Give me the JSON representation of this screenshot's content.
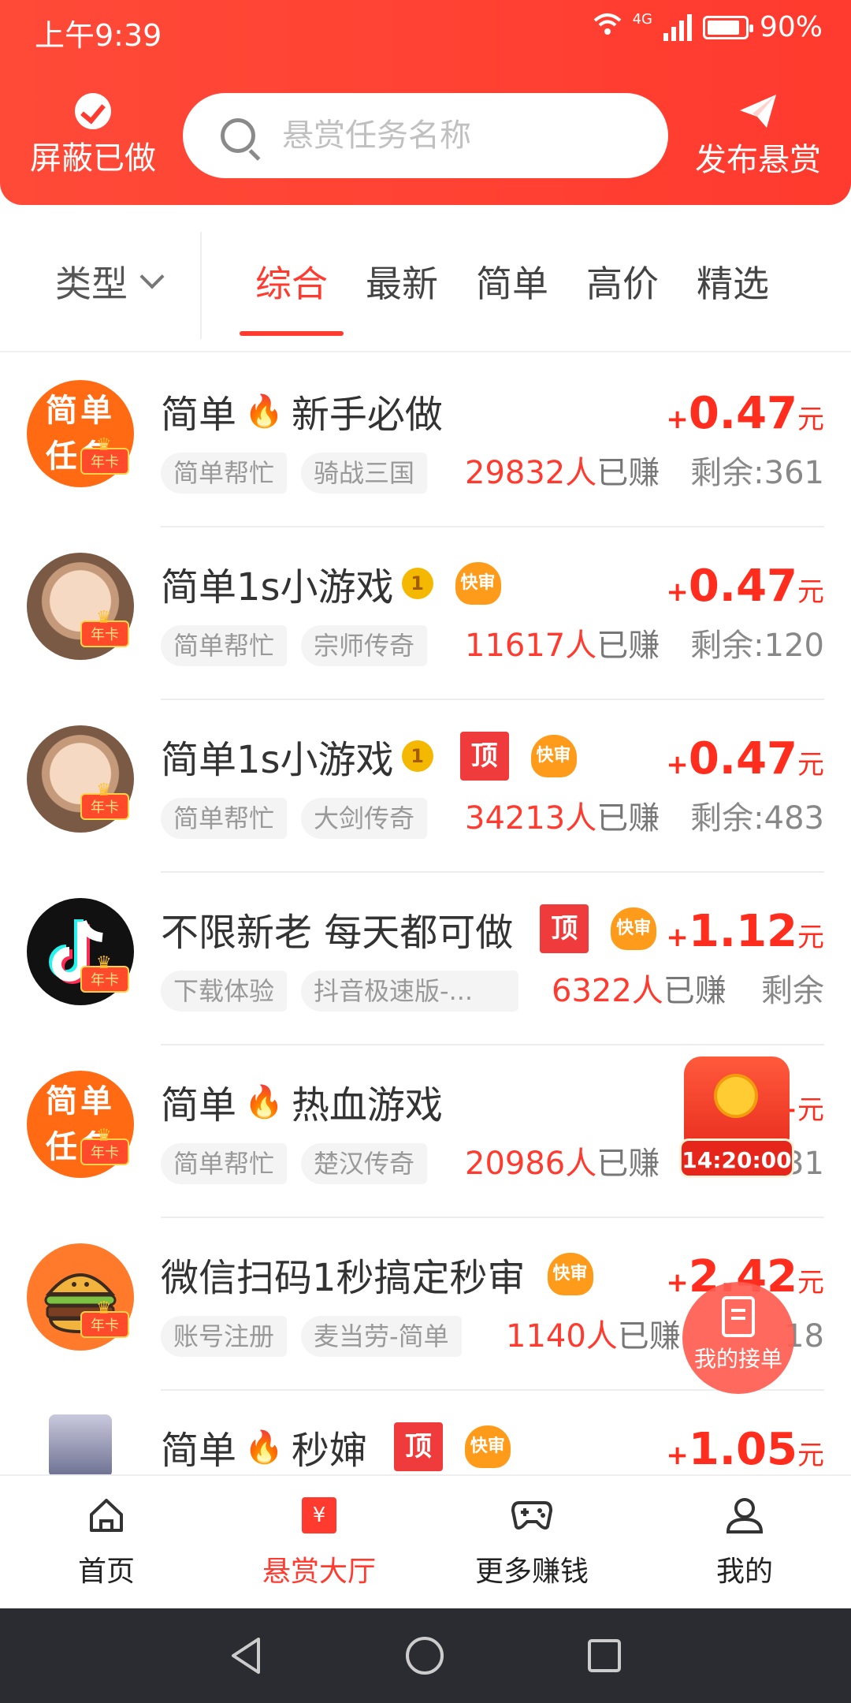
{
  "status": {
    "time": "上午9:39",
    "network": "4G",
    "battery": "90%"
  },
  "header": {
    "hide_done": "屏蔽已做",
    "search_placeholder": "悬赏任务名称",
    "publish": "发布悬赏"
  },
  "filter": {
    "type_label": "类型",
    "tabs": [
      "综合",
      "最新",
      "简单",
      "高价",
      "精选"
    ],
    "active_tab": "综合"
  },
  "avatars": {
    "simple_task": "简单任务",
    "vip": "年卡"
  },
  "tasks": [
    {
      "title": "简单",
      "title2": "新手必做",
      "icon": "fire",
      "tags": [
        "简单帮忙",
        "骑战三国"
      ],
      "earned": "29832人",
      "earned_suffix": "已赚",
      "remain": "剩余:361",
      "price_plus": "+",
      "price": "0.47",
      "unit": "元",
      "top": false,
      "fast": false,
      "avatar": "orange"
    },
    {
      "title": "简单1s小游戏",
      "title2": "",
      "icon": "medal",
      "tags": [
        "简单帮忙",
        "宗师传奇"
      ],
      "earned": "11617人",
      "earned_suffix": "已赚",
      "remain": "剩余:120",
      "price_plus": "+",
      "price": "0.47",
      "unit": "元",
      "top": false,
      "fast": true,
      "avatar": "girl"
    },
    {
      "title": "简单1s小游戏",
      "title2": "",
      "icon": "medal",
      "tags": [
        "简单帮忙",
        "大剑传奇"
      ],
      "earned": "34213人",
      "earned_suffix": "已赚",
      "remain": "剩余:483",
      "price_plus": "+",
      "price": "0.47",
      "unit": "元",
      "top": true,
      "fast": true,
      "avatar": "girl"
    },
    {
      "title": "不限新老 每天都可做",
      "title2": "",
      "icon": "",
      "tags": [
        "下载体验",
        "抖音极速版-..."
      ],
      "earned": "6322人",
      "earned_suffix": "已赚",
      "remain": "剩余",
      "price_plus": "+",
      "price": "1.12",
      "unit": "元",
      "top": true,
      "fast": true,
      "avatar": "tiktok"
    },
    {
      "title": "简单",
      "title2": "热血游戏",
      "icon": "fire",
      "tags": [
        "简单帮忙",
        "楚汉传奇"
      ],
      "earned": "20986人",
      "earned_suffix": "已赚",
      "remain": "剩余:31",
      "price_plus": "+",
      "price": "",
      "unit": "元",
      "top": false,
      "fast": false,
      "avatar": "orange"
    },
    {
      "title": "微信扫码1秒搞定秒审",
      "title2": "",
      "icon": "",
      "tags": [
        "账号注册",
        "麦当劳-简单"
      ],
      "earned": "1140人",
      "earned_suffix": "已赚",
      "remain": "18",
      "price_plus": "+",
      "price": "2.42",
      "unit": "元",
      "top": false,
      "fast": true,
      "avatar": "burger"
    },
    {
      "title": "简单",
      "title2": "秒婶",
      "icon": "fire",
      "tags": [],
      "earned": "",
      "earned_suffix": "",
      "remain": "",
      "price_plus": "+",
      "price": "1.05",
      "unit": "元",
      "top": true,
      "fast": true,
      "avatar": "photo"
    }
  ],
  "badges": {
    "top": "顶",
    "fast": "快审",
    "medal": "1"
  },
  "floating": {
    "timer": "14:20:00",
    "my_orders": "我的接单"
  },
  "nav": [
    {
      "label": "首页",
      "icon": "home-icon",
      "active": false
    },
    {
      "label": "悬赏大厅",
      "icon": "yen-icon",
      "active": true
    },
    {
      "label": "更多赚钱",
      "icon": "gamepad-icon",
      "active": false
    },
    {
      "label": "我的",
      "icon": "user-icon",
      "active": false
    }
  ],
  "nav_yen": "¥",
  "colors": {
    "primary": "#ff3a2e",
    "price": "#ff2d1d"
  }
}
